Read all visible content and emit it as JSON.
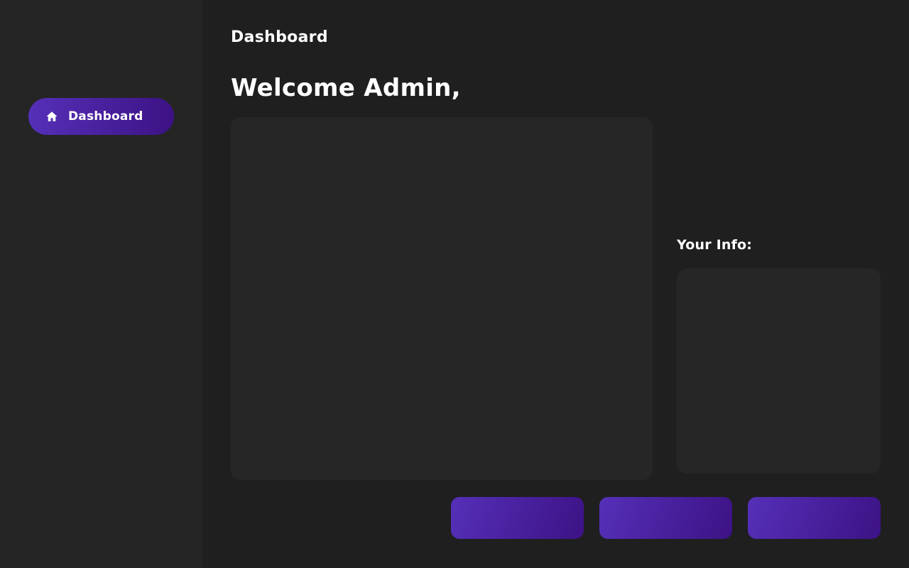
{
  "sidebar": {
    "items": [
      {
        "label": "Dashboard",
        "icon": "home-icon",
        "active": true
      }
    ]
  },
  "header": {
    "title": "Dashboard"
  },
  "main": {
    "welcome": "Welcome Admin,",
    "info_title": "Your Info:"
  },
  "colors": {
    "background": "#1f1f1f",
    "sidebar": "#252525",
    "card": "#262626",
    "accent_start": "#5530b8",
    "accent_end": "#3d1285",
    "text": "#ffffff"
  }
}
